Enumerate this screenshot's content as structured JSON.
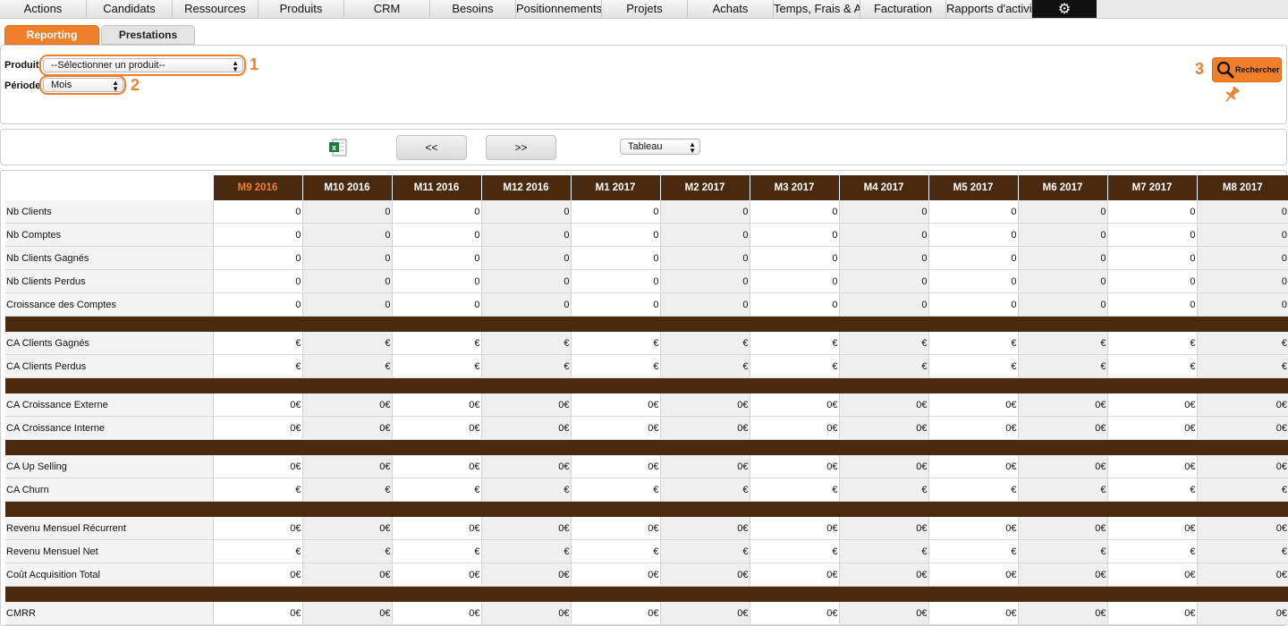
{
  "nav": {
    "items": [
      "Actions",
      "Candidats",
      "Ressources",
      "Produits",
      "CRM",
      "Besoins",
      "Positionnements",
      "Projets",
      "Achats",
      "Temps, Frais & Absences",
      "Facturation",
      "Rapports d'activité"
    ],
    "settings_icon": "gear-icon"
  },
  "tabs": {
    "reporting": "Reporting",
    "prestations": "Prestations"
  },
  "filters": {
    "produit_label": "Produit",
    "produit_value": "--Sélectionner un produit--",
    "periode_label": "Période",
    "periode_value": "Mois",
    "markers": [
      "1",
      "2",
      "3"
    ],
    "search_label": "Rechercher"
  },
  "toolbar": {
    "prev": "<<",
    "next": ">>",
    "view": "Tableau",
    "excel_icon": "excel-export-icon"
  },
  "table": {
    "columns": [
      "M9 2016",
      "M10 2016",
      "M11 2016",
      "M12 2016",
      "M1 2017",
      "M2 2017",
      "M3 2017",
      "M4 2017",
      "M5 2017",
      "M6 2017",
      "M7 2017",
      "M8 2017"
    ],
    "current_column": "M9 2016",
    "rows": [
      {
        "label": "Nb Clients",
        "value": "0"
      },
      {
        "label": "Nb Comptes",
        "value": "0"
      },
      {
        "label": "Nb Clients Gagnés",
        "value": "0"
      },
      {
        "label": "Nb Clients Perdus",
        "value": "0"
      },
      {
        "label": "Croissance des Comptes",
        "value": "0"
      },
      {
        "separator": true
      },
      {
        "label": "CA Clients Gagnés",
        "value": "€"
      },
      {
        "label": "CA Clients Perdus",
        "value": "€"
      },
      {
        "separator": true
      },
      {
        "label": "CA Croissance Externe",
        "value": "0€"
      },
      {
        "label": "CA Croissance Interne",
        "value": "0€"
      },
      {
        "separator": true
      },
      {
        "label": "CA Up Selling",
        "value": "0€"
      },
      {
        "label": "CA Churn",
        "value": "€"
      },
      {
        "separator": true
      },
      {
        "label": "Revenu Mensuel Récurrent",
        "value": "0€"
      },
      {
        "label": "Revenu Mensuel Net",
        "value": "€"
      },
      {
        "label": "Coût Acquisition Total",
        "value": "0€"
      },
      {
        "separator": true
      },
      {
        "label": "CMRR",
        "value": "0€"
      }
    ]
  },
  "colors": {
    "accent": "#f07f2c",
    "header_brown": "#4a2a0e"
  }
}
